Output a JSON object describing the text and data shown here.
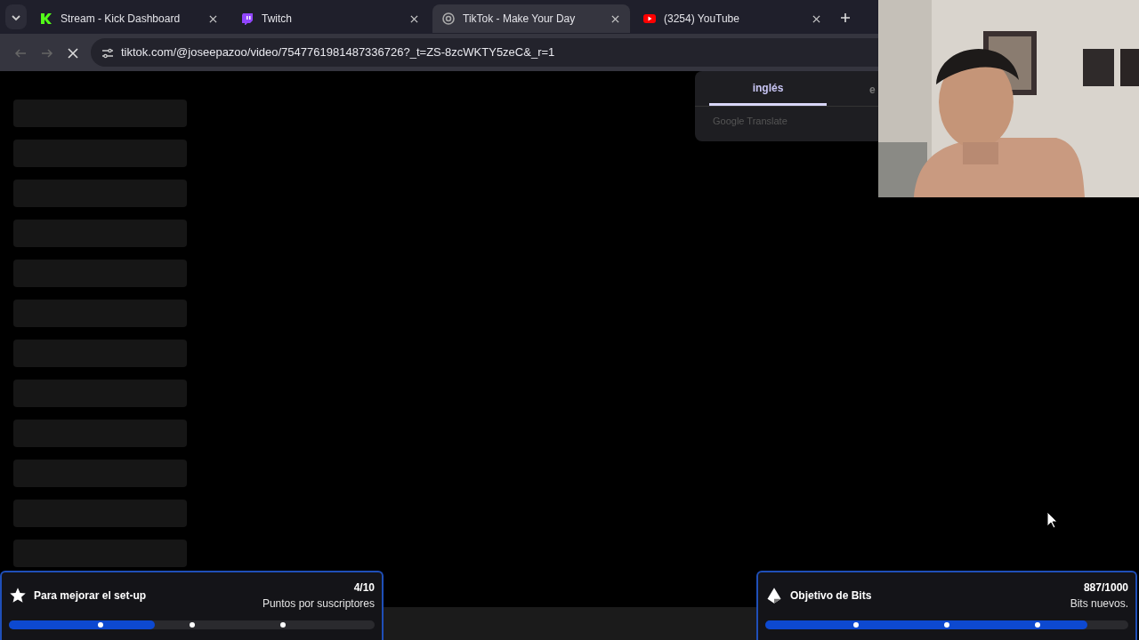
{
  "tabs": [
    {
      "title": "Stream - Kick Dashboard",
      "kind": "kick",
      "selected": false
    },
    {
      "title": "Twitch",
      "kind": "twitch",
      "selected": false
    },
    {
      "title": "TikTok - Make Your Day",
      "kind": "tiktok",
      "selected": true
    },
    {
      "title": "(3254) YouTube",
      "kind": "youtube",
      "selected": false
    }
  ],
  "address_bar": {
    "url": "tiktok.com/@joseepazoo/video/7547761981487336726?_t=ZS-8zcWKTY5zeC&_r=1",
    "loading": true
  },
  "translate_popup": {
    "languages": [
      {
        "label": "inglés",
        "selected": true
      },
      {
        "label": "e",
        "selected": false
      }
    ],
    "footer": "Google Translate"
  },
  "goals": [
    {
      "kind": "stars",
      "title": "Para mejorar el set-up",
      "count": "4/10",
      "subtitle": "Puntos por suscriptores",
      "level": 0.4
    },
    {
      "kind": "bits",
      "title": "Objetivo de Bits",
      "count": "887/1000",
      "subtitle": "Bits nuevos.",
      "level": 0.887
    }
  ]
}
